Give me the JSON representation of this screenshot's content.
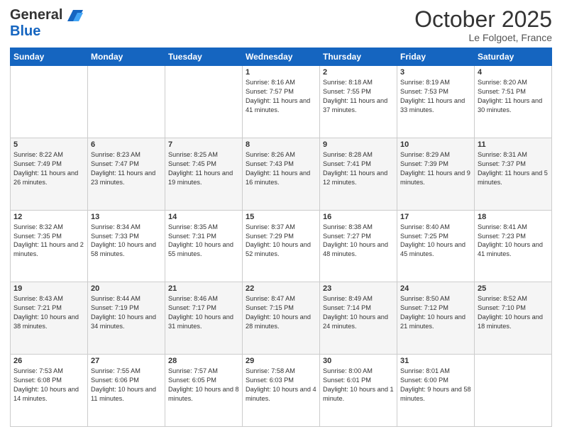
{
  "header": {
    "logo_general": "General",
    "logo_blue": "Blue",
    "month_title": "October 2025",
    "location": "Le Folgoet, France"
  },
  "days_of_week": [
    "Sunday",
    "Monday",
    "Tuesday",
    "Wednesday",
    "Thursday",
    "Friday",
    "Saturday"
  ],
  "weeks": [
    [
      {
        "day": "",
        "info": ""
      },
      {
        "day": "",
        "info": ""
      },
      {
        "day": "",
        "info": ""
      },
      {
        "day": "1",
        "info": "Sunrise: 8:16 AM\nSunset: 7:57 PM\nDaylight: 11 hours and 41 minutes."
      },
      {
        "day": "2",
        "info": "Sunrise: 8:18 AM\nSunset: 7:55 PM\nDaylight: 11 hours and 37 minutes."
      },
      {
        "day": "3",
        "info": "Sunrise: 8:19 AM\nSunset: 7:53 PM\nDaylight: 11 hours and 33 minutes."
      },
      {
        "day": "4",
        "info": "Sunrise: 8:20 AM\nSunset: 7:51 PM\nDaylight: 11 hours and 30 minutes."
      }
    ],
    [
      {
        "day": "5",
        "info": "Sunrise: 8:22 AM\nSunset: 7:49 PM\nDaylight: 11 hours and 26 minutes."
      },
      {
        "day": "6",
        "info": "Sunrise: 8:23 AM\nSunset: 7:47 PM\nDaylight: 11 hours and 23 minutes."
      },
      {
        "day": "7",
        "info": "Sunrise: 8:25 AM\nSunset: 7:45 PM\nDaylight: 11 hours and 19 minutes."
      },
      {
        "day": "8",
        "info": "Sunrise: 8:26 AM\nSunset: 7:43 PM\nDaylight: 11 hours and 16 minutes."
      },
      {
        "day": "9",
        "info": "Sunrise: 8:28 AM\nSunset: 7:41 PM\nDaylight: 11 hours and 12 minutes."
      },
      {
        "day": "10",
        "info": "Sunrise: 8:29 AM\nSunset: 7:39 PM\nDaylight: 11 hours and 9 minutes."
      },
      {
        "day": "11",
        "info": "Sunrise: 8:31 AM\nSunset: 7:37 PM\nDaylight: 11 hours and 5 minutes."
      }
    ],
    [
      {
        "day": "12",
        "info": "Sunrise: 8:32 AM\nSunset: 7:35 PM\nDaylight: 11 hours and 2 minutes."
      },
      {
        "day": "13",
        "info": "Sunrise: 8:34 AM\nSunset: 7:33 PM\nDaylight: 10 hours and 58 minutes."
      },
      {
        "day": "14",
        "info": "Sunrise: 8:35 AM\nSunset: 7:31 PM\nDaylight: 10 hours and 55 minutes."
      },
      {
        "day": "15",
        "info": "Sunrise: 8:37 AM\nSunset: 7:29 PM\nDaylight: 10 hours and 52 minutes."
      },
      {
        "day": "16",
        "info": "Sunrise: 8:38 AM\nSunset: 7:27 PM\nDaylight: 10 hours and 48 minutes."
      },
      {
        "day": "17",
        "info": "Sunrise: 8:40 AM\nSunset: 7:25 PM\nDaylight: 10 hours and 45 minutes."
      },
      {
        "day": "18",
        "info": "Sunrise: 8:41 AM\nSunset: 7:23 PM\nDaylight: 10 hours and 41 minutes."
      }
    ],
    [
      {
        "day": "19",
        "info": "Sunrise: 8:43 AM\nSunset: 7:21 PM\nDaylight: 10 hours and 38 minutes."
      },
      {
        "day": "20",
        "info": "Sunrise: 8:44 AM\nSunset: 7:19 PM\nDaylight: 10 hours and 34 minutes."
      },
      {
        "day": "21",
        "info": "Sunrise: 8:46 AM\nSunset: 7:17 PM\nDaylight: 10 hours and 31 minutes."
      },
      {
        "day": "22",
        "info": "Sunrise: 8:47 AM\nSunset: 7:15 PM\nDaylight: 10 hours and 28 minutes."
      },
      {
        "day": "23",
        "info": "Sunrise: 8:49 AM\nSunset: 7:14 PM\nDaylight: 10 hours and 24 minutes."
      },
      {
        "day": "24",
        "info": "Sunrise: 8:50 AM\nSunset: 7:12 PM\nDaylight: 10 hours and 21 minutes."
      },
      {
        "day": "25",
        "info": "Sunrise: 8:52 AM\nSunset: 7:10 PM\nDaylight: 10 hours and 18 minutes."
      }
    ],
    [
      {
        "day": "26",
        "info": "Sunrise: 7:53 AM\nSunset: 6:08 PM\nDaylight: 10 hours and 14 minutes."
      },
      {
        "day": "27",
        "info": "Sunrise: 7:55 AM\nSunset: 6:06 PM\nDaylight: 10 hours and 11 minutes."
      },
      {
        "day": "28",
        "info": "Sunrise: 7:57 AM\nSunset: 6:05 PM\nDaylight: 10 hours and 8 minutes."
      },
      {
        "day": "29",
        "info": "Sunrise: 7:58 AM\nSunset: 6:03 PM\nDaylight: 10 hours and 4 minutes."
      },
      {
        "day": "30",
        "info": "Sunrise: 8:00 AM\nSunset: 6:01 PM\nDaylight: 10 hours and 1 minute."
      },
      {
        "day": "31",
        "info": "Sunrise: 8:01 AM\nSunset: 6:00 PM\nDaylight: 9 hours and 58 minutes."
      },
      {
        "day": "",
        "info": ""
      }
    ]
  ]
}
